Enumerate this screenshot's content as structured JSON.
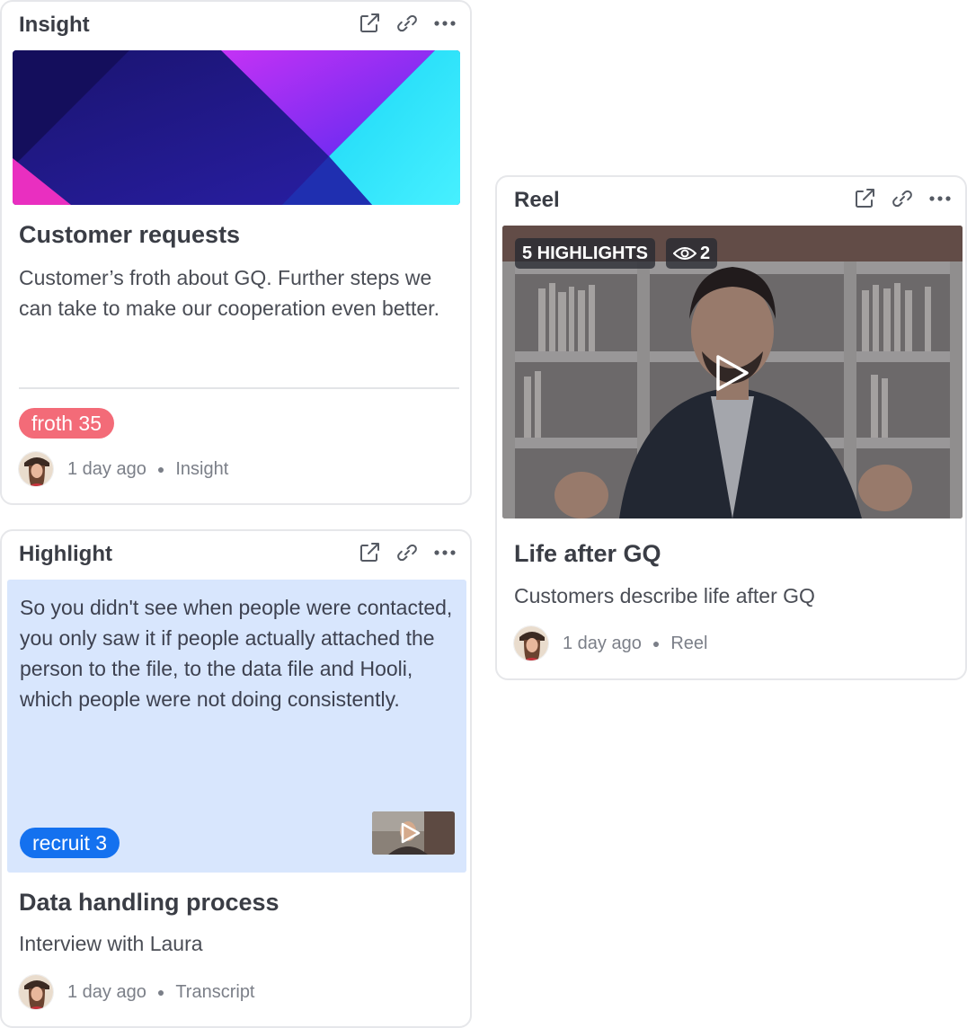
{
  "cards": {
    "insight": {
      "type_label": "Insight",
      "title": "Customer requests",
      "description": "Customer’s froth about GQ. Further steps we can take to make our cooperation even better.",
      "tag": {
        "label": "froth 35",
        "color": "#f36b78"
      },
      "meta": {
        "time": "1 day ago",
        "kind": "Insight"
      }
    },
    "highlight": {
      "type_label": "Highlight",
      "quote": "So you didn't see when people were contacted, you only saw it if people actually attached the person to the file, to the data file and Hooli, which people were not doing consistently.",
      "tag": {
        "label": "recruit 3",
        "color": "#1471ef"
      },
      "quote_bg": "#d8e6fd",
      "title": "Data handling process",
      "description": "Interview with Laura",
      "meta": {
        "time": "1 day ago",
        "kind": "Transcript"
      }
    },
    "reel": {
      "type_label": "Reel",
      "highlights_badge": "5 HIGHLIGHTS",
      "views": "2",
      "title": "Life after GQ",
      "description": "Customers describe life after GQ",
      "meta": {
        "time": "1 day ago",
        "kind": "Reel"
      }
    }
  },
  "icons": [
    "open-external-icon",
    "link-icon",
    "more-icon",
    "play-icon",
    "eye-icon"
  ]
}
